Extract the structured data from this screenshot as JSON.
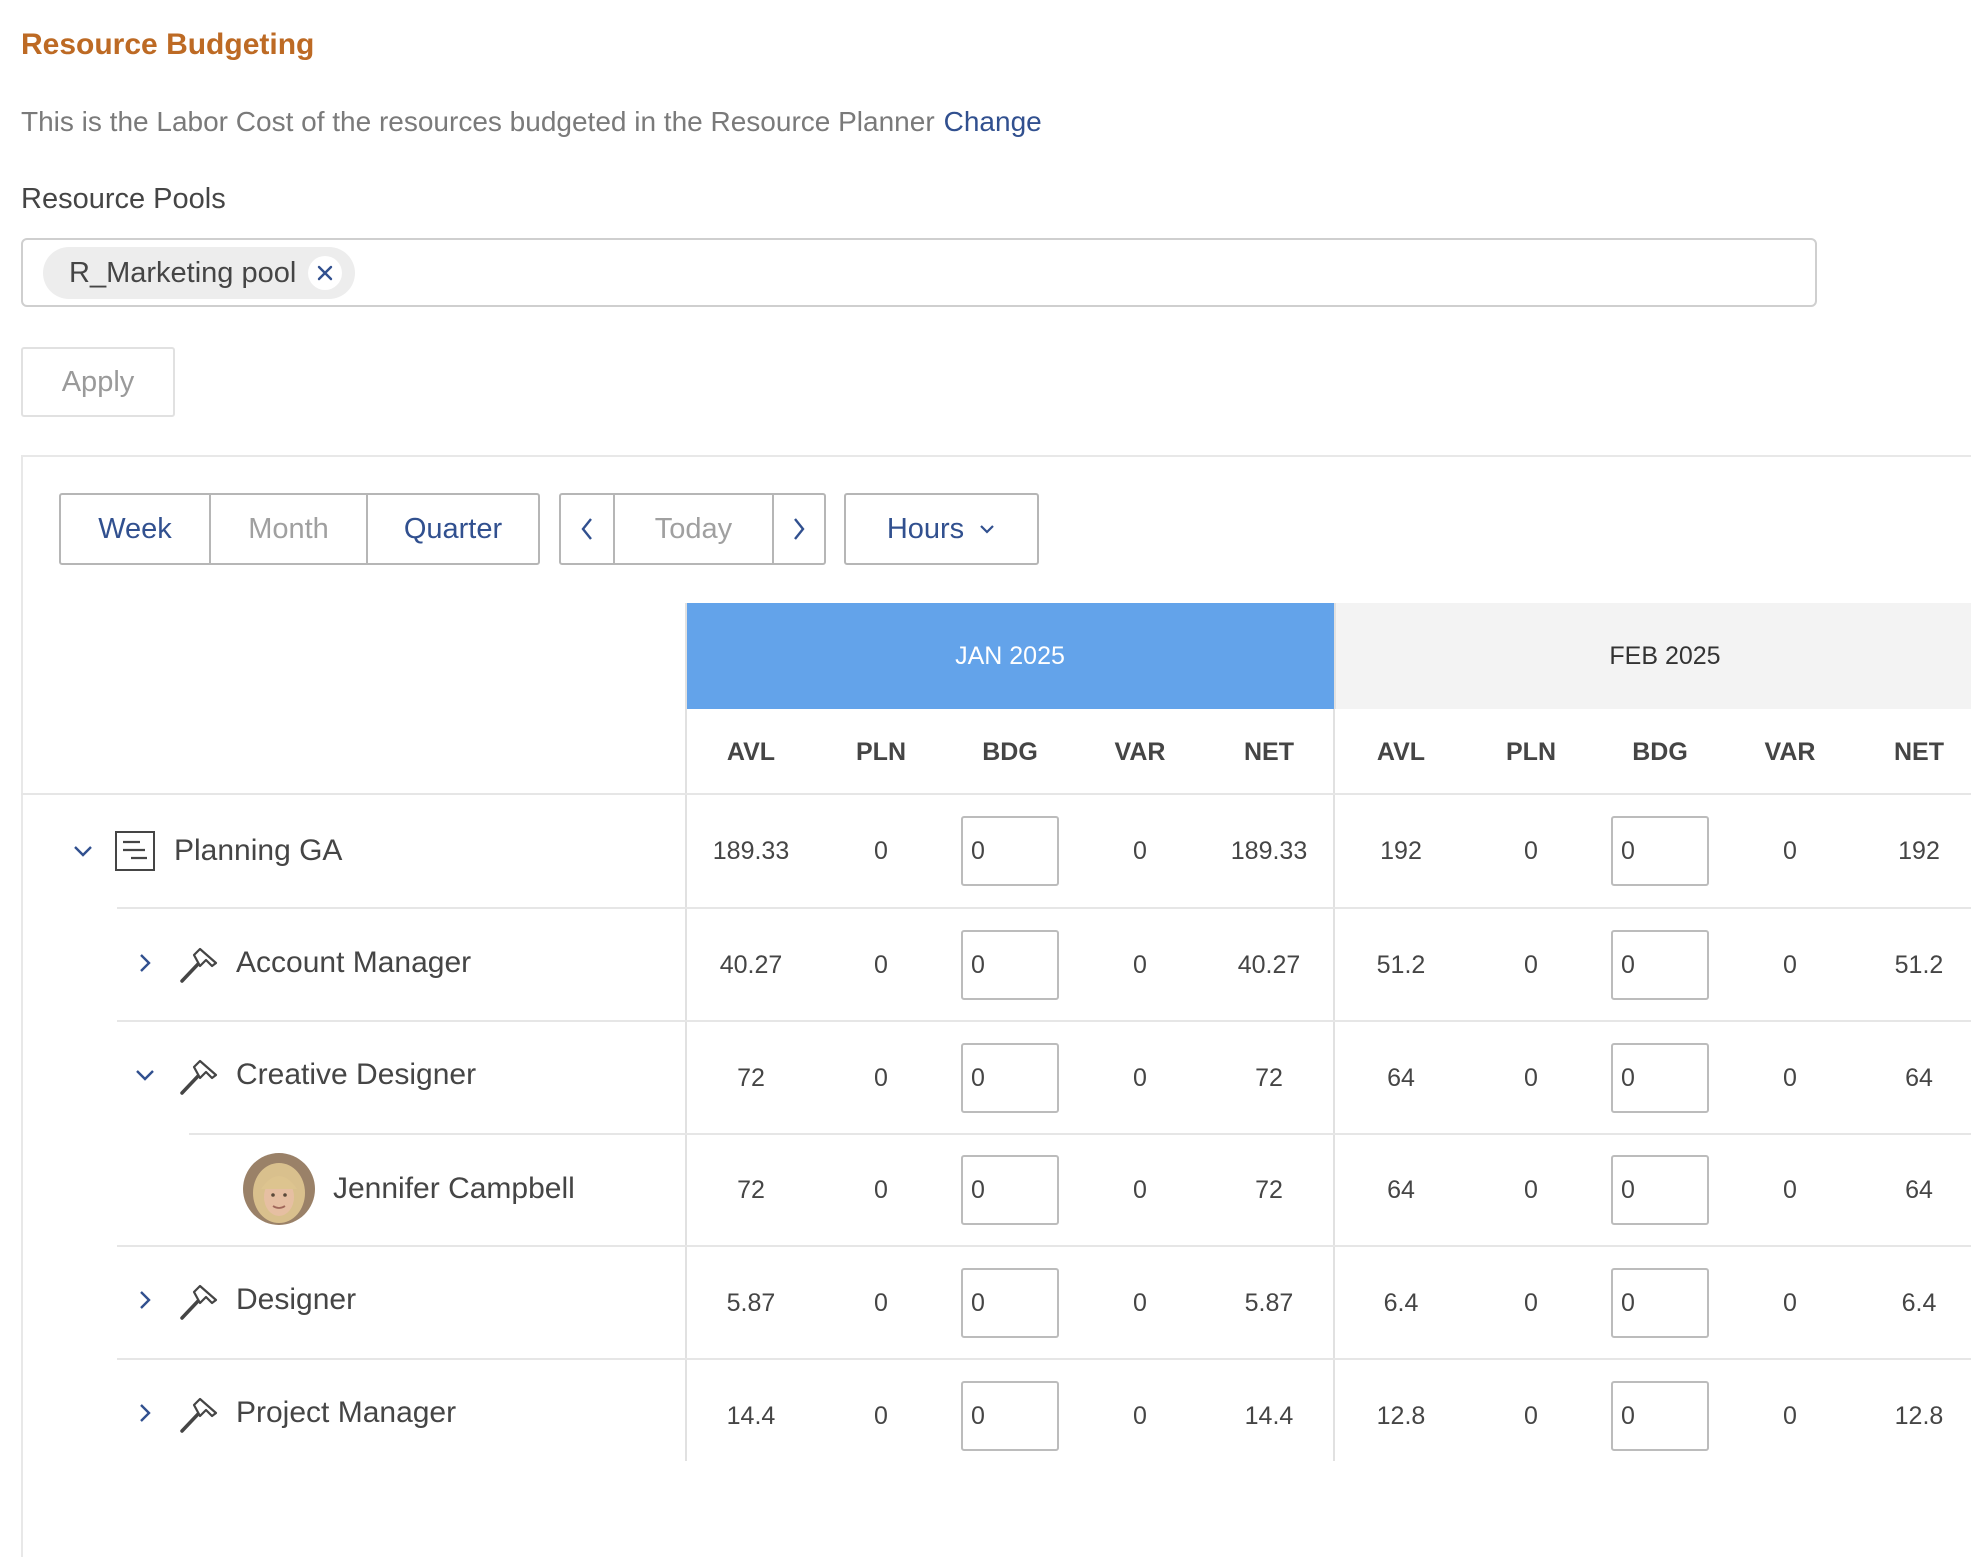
{
  "header": {
    "title": "Resource Budgeting",
    "description": "This is the Labor Cost of the resources budgeted in the Resource Planner",
    "change_link": "Change"
  },
  "resource_pools": {
    "label": "Resource Pools",
    "chips": [
      "R_Marketing pool"
    ],
    "chip_remove": "×"
  },
  "apply_label": "Apply",
  "toolbar": {
    "views": [
      "Week",
      "Month",
      "Quarter"
    ],
    "active_views": [
      "Week",
      "Quarter"
    ],
    "prev_icon": "chevron-left-icon",
    "today_label": "Today",
    "next_icon": "chevron-right-icon",
    "unit_label": "Hours"
  },
  "grid": {
    "months": [
      "JAN 2025",
      "FEB 2025"
    ],
    "columns": [
      "AVL",
      "PLN",
      "BDG",
      "VAR",
      "NET"
    ],
    "rows": [
      {
        "label": "Planning GA",
        "type": "project",
        "expanded": true,
        "jan": {
          "AVL": "189.33",
          "PLN": "0",
          "BDG": "0",
          "VAR": "0",
          "NET": "189.33"
        },
        "feb": {
          "AVL": "192",
          "PLN": "0",
          "BDG": "0",
          "VAR": "0",
          "NET": "192"
        }
      },
      {
        "label": "Account Manager",
        "type": "role",
        "expanded": false,
        "jan": {
          "AVL": "40.27",
          "PLN": "0",
          "BDG": "0",
          "VAR": "0",
          "NET": "40.27"
        },
        "feb": {
          "AVL": "51.2",
          "PLN": "0",
          "BDG": "0",
          "VAR": "0",
          "NET": "51.2"
        }
      },
      {
        "label": "Creative Designer",
        "type": "role",
        "expanded": true,
        "jan": {
          "AVL": "72",
          "PLN": "0",
          "BDG": "0",
          "VAR": "0",
          "NET": "72"
        },
        "feb": {
          "AVL": "64",
          "PLN": "0",
          "BDG": "0",
          "VAR": "0",
          "NET": "64"
        }
      },
      {
        "label": "Jennifer Campbell",
        "type": "user",
        "jan": {
          "AVL": "72",
          "PLN": "0",
          "BDG": "0",
          "VAR": "0",
          "NET": "72"
        },
        "feb": {
          "AVL": "64",
          "PLN": "0",
          "BDG": "0",
          "VAR": "0",
          "NET": "64"
        }
      },
      {
        "label": "Designer",
        "type": "role",
        "expanded": false,
        "jan": {
          "AVL": "5.87",
          "PLN": "0",
          "BDG": "0",
          "VAR": "0",
          "NET": "5.87"
        },
        "feb": {
          "AVL": "6.4",
          "PLN": "0",
          "BDG": "0",
          "VAR": "0",
          "NET": "6.4"
        }
      },
      {
        "label": "Project Manager",
        "type": "role",
        "expanded": false,
        "jan": {
          "AVL": "14.4",
          "PLN": "0",
          "BDG": "0",
          "VAR": "0",
          "NET": "14.4"
        },
        "feb": {
          "AVL": "12.8",
          "PLN": "0",
          "BDG": "0",
          "VAR": "0",
          "NET": "12.8"
        }
      }
    ]
  },
  "colors": {
    "title": "#bd6a24",
    "link": "#31508f",
    "active_month": "#63a3ea"
  }
}
